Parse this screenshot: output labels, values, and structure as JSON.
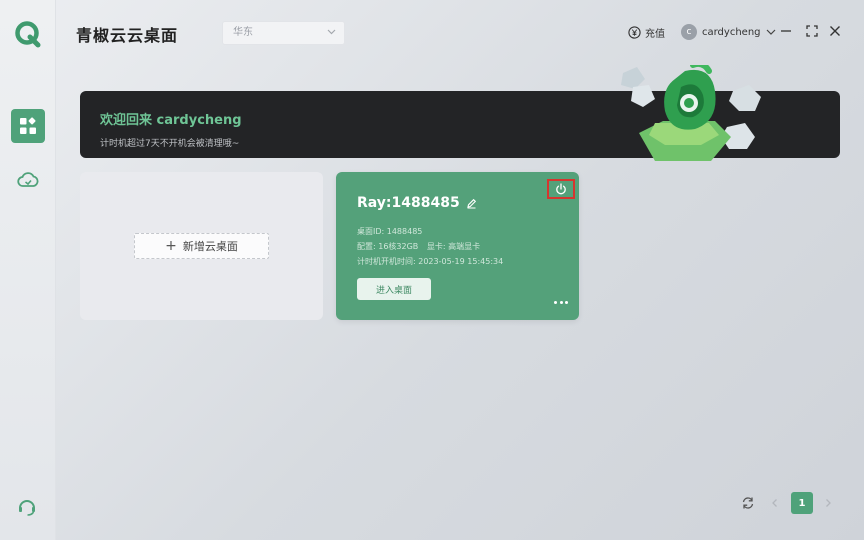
{
  "app": {
    "title": "青椒云云桌面"
  },
  "region": {
    "selected": "华东"
  },
  "header": {
    "recharge_label": "充值",
    "username": "cardycheng",
    "avatar_letter": "c"
  },
  "banner": {
    "title": "欢迎回来 cardycheng",
    "subtitle": "计时机超过7天不开机会被清理哦~"
  },
  "add_card": {
    "label": "新增云桌面"
  },
  "desktop_card": {
    "name": "Ray:1488485",
    "desktop_id": "桌面ID: 1488485",
    "config": "配置: 16核32GB",
    "gpu": "显卡: 高端显卡",
    "boot_time": "计时机开机时间: 2023-05-19 15:45:34",
    "enter_label": "进入桌面"
  },
  "pagination": {
    "current_page": "1"
  },
  "colors": {
    "accent": "#4fa27a",
    "card_green": "#54a17a",
    "banner_bg": "#232426",
    "highlight_red": "#d6362f"
  }
}
